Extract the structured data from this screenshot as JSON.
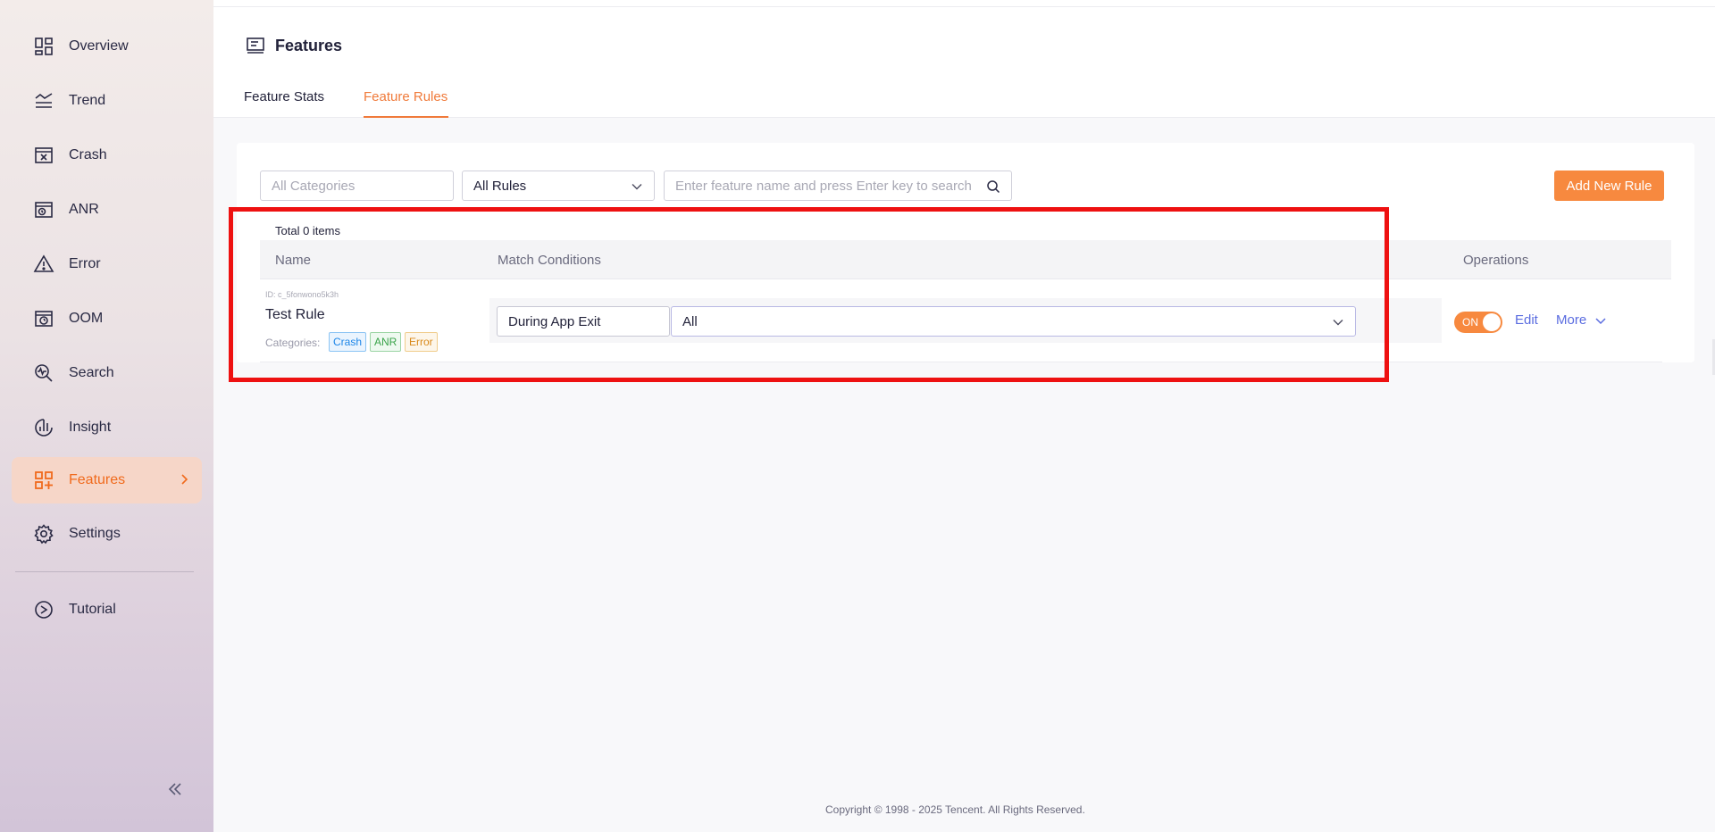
{
  "sidebar": {
    "items": [
      {
        "label": "Overview",
        "icon": "overview-icon"
      },
      {
        "label": "Trend",
        "icon": "trend-icon"
      },
      {
        "label": "Crash",
        "icon": "crash-icon"
      },
      {
        "label": "ANR",
        "icon": "anr-icon"
      },
      {
        "label": "Error",
        "icon": "error-icon"
      },
      {
        "label": "OOM",
        "icon": "oom-icon"
      },
      {
        "label": "Search",
        "icon": "search-icon"
      },
      {
        "label": "Insight",
        "icon": "insight-icon"
      },
      {
        "label": "Features",
        "icon": "features-icon",
        "active": true
      },
      {
        "label": "Settings",
        "icon": "settings-icon"
      },
      {
        "label": "Tutorial",
        "icon": "tutorial-icon"
      }
    ],
    "collapse_icon": "double-chevron-left-icon"
  },
  "header": {
    "title": "Features",
    "tabs": [
      {
        "label": "Feature Stats"
      },
      {
        "label": "Feature Rules",
        "active": true
      }
    ]
  },
  "filters": {
    "category_placeholder": "All Categories",
    "rules_value": "All Rules",
    "search_placeholder": "Enter feature name and press Enter key to search",
    "add_button": "Add New Rule"
  },
  "table": {
    "total": "Total 0 items",
    "columns": [
      "Name",
      "Match Conditions",
      "Operations"
    ],
    "rows": [
      {
        "id": "ID: c_5fonwono5k3h",
        "name": "Test Rule",
        "categories_label": "Categories:",
        "categories": [
          "Crash",
          "ANR",
          "Error"
        ],
        "condition_when": "During App Exit",
        "condition_value": "All",
        "toggle": "ON",
        "edit": "Edit",
        "more": "More"
      }
    ]
  },
  "footer": {
    "copyright": "Copyright © 1998 - 2025 Tencent. All Rights Reserved."
  },
  "colors": {
    "accent": "#f7893f",
    "link": "#5a6ce0",
    "annotation": "#ee1111"
  }
}
